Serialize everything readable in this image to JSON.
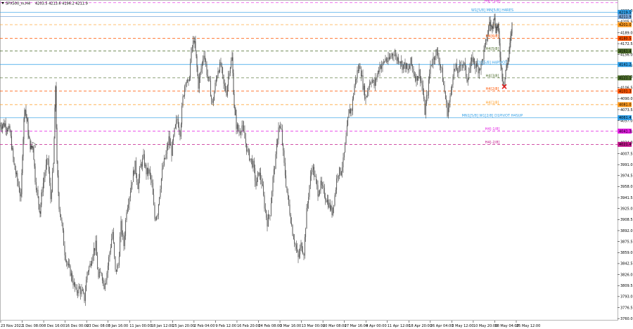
{
  "header": {
    "symbol_tf": "SPX500_m,H4",
    "ohlc": "4203.5 4213.6 4196.2 4211.9"
  },
  "chart_data": {
    "type": "candlestick",
    "y_axis_labels": [
      4222.0,
      4205.5,
      4189.0,
      4172.5,
      4156.0,
      4139.5,
      4123.0,
      4106.5,
      4090.0,
      4073.5,
      4057.0,
      4040.5,
      4024.0,
      4007.5,
      3991.0,
      3974.5,
      3958.0,
      3941.5,
      3925.0,
      3908.5,
      3892.0,
      3875.5,
      3859.0,
      3842.5,
      3826.0,
      3809.5,
      3793.0,
      3776.5,
      3760.0
    ],
    "ylim": [
      3757.0,
      4238.0
    ],
    "x_axis_labels": [
      "23 Nov 2022",
      "1 Dec 08:00",
      "8 Dec 16:00",
      "16 Dec 00:00",
      "23 Dec 08:00",
      "3 Jan 16:00",
      "11 Jan 00:00",
      "18 Jan 12:00",
      "25 Jan 20:00",
      "2 Feb 04:00",
      "9 Feb 12:00",
      "16 Feb 20:00",
      "24 Feb 08:00",
      "3 Mar 16:00",
      "13 Mar 00:00",
      "20 Mar 08:00",
      "27 Mar 16:00",
      "4 Apr 00:00",
      "11 Apr 12:00",
      "18 Apr 20:00",
      "26 Apr 04:00",
      "3 May 12:00",
      "10 May 20:00",
      "18 May 04:00",
      "25 May 12:00"
    ],
    "price_line_value": 4211.9,
    "levels": [
      {
        "label": "H4[+1/8]",
        "value": 4234.0,
        "color": "#e21ee2",
        "style": "dash",
        "tag": ""
      },
      {
        "label": "W1[5/8] MN[5/8] H4RES",
        "value": 4219.5,
        "color": "#2f9ee6",
        "style": "solid",
        "tag": "4219.5"
      },
      {
        "label": "",
        "value": 4213.2,
        "color": "#7aa7d8",
        "style": "solid",
        "tag": "4211.9"
      },
      {
        "label": "",
        "value": 4201.0,
        "color": "#ff9a1e",
        "style": "dash",
        "tag": "4201.0"
      },
      {
        "label": "H4[6/8]",
        "value": 4180.5,
        "color": "#ff5500",
        "style": "dash",
        "tag": "4180.5"
      },
      {
        "label": "H4[5/8]",
        "value": 4161.4,
        "color": "#4b6b2a",
        "style": "dash",
        "tag": "4161.4"
      },
      {
        "label": "D1[5/8] H4PIVOT",
        "value": 4141.2,
        "color": "#2f9ee6",
        "style": "solid",
        "tag": "4141.2"
      },
      {
        "label": "H4[3/8]",
        "value": 4121.1,
        "color": "#4b6b2a",
        "style": "dash",
        "tag": "4121.1"
      },
      {
        "label": "H4[2/8]",
        "value": 4101.3,
        "color": "#ff5500",
        "style": "dash",
        "tag": "4101.3"
      },
      {
        "label": "H4[1/8]",
        "value": 4081.0,
        "color": "#ff9a1e",
        "style": "dash",
        "tag": "4081.0"
      },
      {
        "label": "MN1[5/8] W1[2/8] D1PIVOT H4SUP",
        "value": 4061.4,
        "color": "#2f9ee6",
        "style": "solid",
        "tag": "4061.4"
      },
      {
        "label": "H4[-1/8]",
        "value": 4041.3,
        "color": "#e21ee2",
        "style": "dash",
        "tag": "4041.3"
      },
      {
        "label": "H4[-2/8]",
        "value": 4021.4,
        "color": "#c2188c",
        "style": "dash",
        "tag": "4021.4"
      }
    ],
    "close_path": [
      [
        0,
        4050
      ],
      [
        7,
        4052
      ],
      [
        14,
        4040
      ],
      [
        20,
        3990
      ],
      [
        26,
        3960
      ],
      [
        30,
        3940
      ],
      [
        32,
        4010
      ],
      [
        35,
        4080
      ],
      [
        38,
        4060
      ],
      [
        41,
        4030
      ],
      [
        44,
        4015
      ],
      [
        47,
        4020
      ],
      [
        50,
        3970
      ],
      [
        54,
        3940
      ],
      [
        57,
        3920
      ],
      [
        60,
        3955
      ],
      [
        64,
        3980
      ],
      [
        68,
        4000
      ],
      [
        72,
        3940
      ],
      [
        76,
        3990
      ],
      [
        79,
        4110
      ],
      [
        81,
        3990
      ],
      [
        84,
        3930
      ],
      [
        88,
        3900
      ],
      [
        92,
        3860
      ],
      [
        96,
        3840
      ],
      [
        100,
        3830
      ],
      [
        104,
        3815
      ],
      [
        108,
        3800
      ],
      [
        112,
        3805
      ],
      [
        116,
        3800
      ],
      [
        120,
        3790
      ],
      [
        124,
        3830
      ],
      [
        128,
        3840
      ],
      [
        132,
        3860
      ],
      [
        136,
        3870
      ],
      [
        140,
        3820
      ],
      [
        144,
        3830
      ],
      [
        148,
        3810
      ],
      [
        152,
        3830
      ],
      [
        156,
        3860
      ],
      [
        160,
        3890
      ],
      [
        164,
        3830
      ],
      [
        168,
        3840
      ],
      [
        172,
        3900
      ],
      [
        176,
        3870
      ],
      [
        180,
        3925
      ],
      [
        184,
        3945
      ],
      [
        188,
        3970
      ],
      [
        192,
        3990
      ],
      [
        196,
        3960
      ],
      [
        200,
        3990
      ],
      [
        204,
        4000
      ],
      [
        208,
        3980
      ],
      [
        212,
        3980
      ],
      [
        216,
        3960
      ],
      [
        220,
        3910
      ],
      [
        224,
        3920
      ],
      [
        228,
        3960
      ],
      [
        232,
        3990
      ],
      [
        236,
        4005
      ],
      [
        240,
        4030
      ],
      [
        244,
        4010
      ],
      [
        248,
        4040
      ],
      [
        252,
        4060
      ],
      [
        256,
        4040
      ],
      [
        260,
        4090
      ],
      [
        264,
        4120
      ],
      [
        268,
        4110
      ],
      [
        272,
        4160
      ],
      [
        276,
        4180
      ],
      [
        279,
        4150
      ],
      [
        282,
        4110
      ],
      [
        286,
        4135
      ],
      [
        290,
        4160
      ],
      [
        294,
        4130
      ],
      [
        298,
        4110
      ],
      [
        302,
        4080
      ],
      [
        306,
        4110
      ],
      [
        310,
        4135
      ],
      [
        314,
        4140
      ],
      [
        318,
        4110
      ],
      [
        322,
        4100
      ],
      [
        326,
        4135
      ],
      [
        330,
        4150
      ],
      [
        333,
        4080
      ],
      [
        336,
        4050
      ],
      [
        340,
        4040
      ],
      [
        344,
        4050
      ],
      [
        348,
        4030
      ],
      [
        352,
        4010
      ],
      [
        356,
        4000
      ],
      [
        360,
        3990
      ],
      [
        364,
        3960
      ],
      [
        368,
        3980
      ],
      [
        372,
        3965
      ],
      [
        376,
        3930
      ],
      [
        380,
        3905
      ],
      [
        384,
        3920
      ],
      [
        388,
        3970
      ],
      [
        392,
        4000
      ],
      [
        396,
        4050
      ],
      [
        400,
        4040
      ],
      [
        404,
        3990
      ],
      [
        408,
        3950
      ],
      [
        412,
        3920
      ],
      [
        416,
        3890
      ],
      [
        420,
        3870
      ],
      [
        424,
        3850
      ],
      [
        428,
        3870
      ],
      [
        432,
        3860
      ],
      [
        436,
        3920
      ],
      [
        440,
        3960
      ],
      [
        444,
        3990
      ],
      [
        448,
        3970
      ],
      [
        452,
        3950
      ],
      [
        456,
        3960
      ],
      [
        460,
        3950
      ],
      [
        464,
        3940
      ],
      [
        468,
        3930
      ],
      [
        472,
        3920
      ],
      [
        476,
        3945
      ],
      [
        480,
        3980
      ],
      [
        484,
        3980
      ],
      [
        488,
        3995
      ],
      [
        492,
        4030
      ],
      [
        496,
        4070
      ],
      [
        500,
        4075
      ],
      [
        504,
        4110
      ],
      [
        508,
        4130
      ],
      [
        512,
        4140
      ],
      [
        516,
        4110
      ],
      [
        520,
        4090
      ],
      [
        524,
        4110
      ],
      [
        528,
        4120
      ],
      [
        532,
        4110
      ],
      [
        536,
        4125
      ],
      [
        540,
        4140
      ],
      [
        544,
        4140
      ],
      [
        548,
        4150
      ],
      [
        552,
        4145
      ],
      [
        556,
        4155
      ],
      [
        560,
        4160
      ],
      [
        564,
        4150
      ],
      [
        568,
        4150
      ],
      [
        572,
        4140
      ],
      [
        576,
        4140
      ],
      [
        580,
        4130
      ],
      [
        584,
        4145
      ],
      [
        588,
        4130
      ],
      [
        592,
        4120
      ],
      [
        596,
        4130
      ],
      [
        600,
        4110
      ],
      [
        604,
        4070
      ],
      [
        608,
        4100
      ],
      [
        612,
        4140
      ],
      [
        616,
        4150
      ],
      [
        620,
        4160
      ],
      [
        624,
        4150
      ],
      [
        628,
        4130
      ],
      [
        632,
        4100
      ],
      [
        636,
        4070
      ],
      [
        640,
        4090
      ],
      [
        644,
        4130
      ],
      [
        648,
        4135
      ],
      [
        652,
        4130
      ],
      [
        656,
        4145
      ],
      [
        660,
        4140
      ],
      [
        664,
        4120
      ],
      [
        668,
        4135
      ],
      [
        672,
        4150
      ],
      [
        676,
        4140
      ],
      [
        680,
        4135
      ],
      [
        684,
        4140
      ],
      [
        688,
        4160
      ],
      [
        692,
        4180
      ],
      [
        696,
        4205
      ],
      [
        699,
        4195
      ],
      [
        702,
        4215
      ],
      [
        705,
        4195
      ],
      [
        708,
        4200
      ],
      [
        711,
        4155
      ],
      [
        714,
        4125
      ],
      [
        717,
        4110
      ],
      [
        720,
        4140
      ],
      [
        723,
        4150
      ],
      [
        726,
        4180
      ],
      [
        729,
        4211
      ]
    ]
  },
  "markers": {
    "cross_icon": "x-mark",
    "cross_color": "#e31a1a"
  },
  "colors": {
    "candle": "#404040",
    "grid": "#e4e4e4"
  }
}
